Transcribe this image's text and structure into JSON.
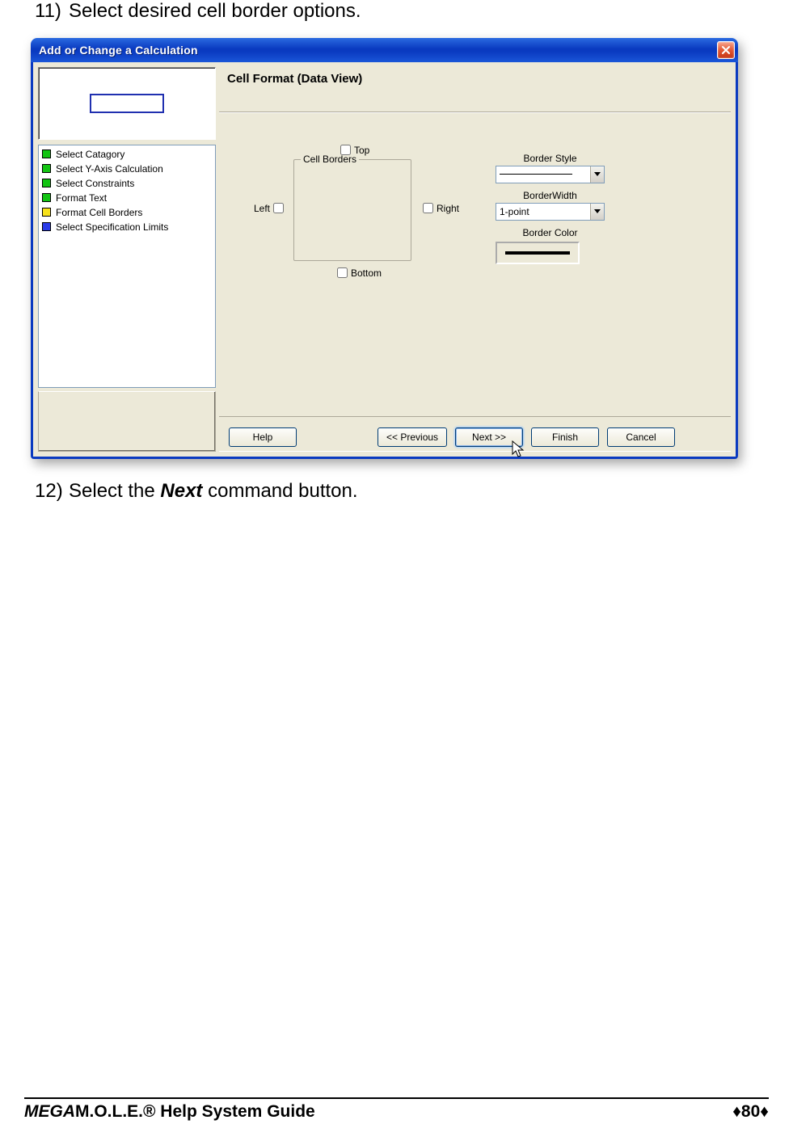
{
  "steps": {
    "s11_num": "11)",
    "s11_text": "Select desired cell border options.",
    "s12_num": "12)",
    "s12_pre": "Select the ",
    "s12_bold": "Next",
    "s12_post": " command button."
  },
  "dialog": {
    "title": "Add or Change a Calculation",
    "close_glyph": "✕",
    "section_title": "Cell Format (Data View)",
    "nav_items": [
      {
        "color": "green",
        "label": "Select Catagory"
      },
      {
        "color": "green",
        "label": "Select Y-Axis Calculation"
      },
      {
        "color": "green",
        "label": "Select Constraints"
      },
      {
        "color": "green",
        "label": "Format Text"
      },
      {
        "color": "yellow",
        "label": "Format Cell Borders"
      },
      {
        "color": "blue",
        "label": "Select Specification Limits"
      }
    ],
    "borders": {
      "legend": "Cell Borders",
      "top": "Top",
      "left": "Left",
      "right": "Right",
      "bottom": "Bottom"
    },
    "style": {
      "border_style_label": "Border Style",
      "border_width_label": "BorderWidth",
      "border_width_value": "1-point",
      "border_color_label": "Border Color"
    },
    "buttons": {
      "help": "Help",
      "prev": "<< Previous",
      "next": "Next >>",
      "finish": "Finish",
      "cancel": "Cancel"
    }
  },
  "footer": {
    "left_prefix": "MEGA",
    "left_rest": "M.O.L.E.® Help System Guide",
    "right": "♦80♦"
  }
}
